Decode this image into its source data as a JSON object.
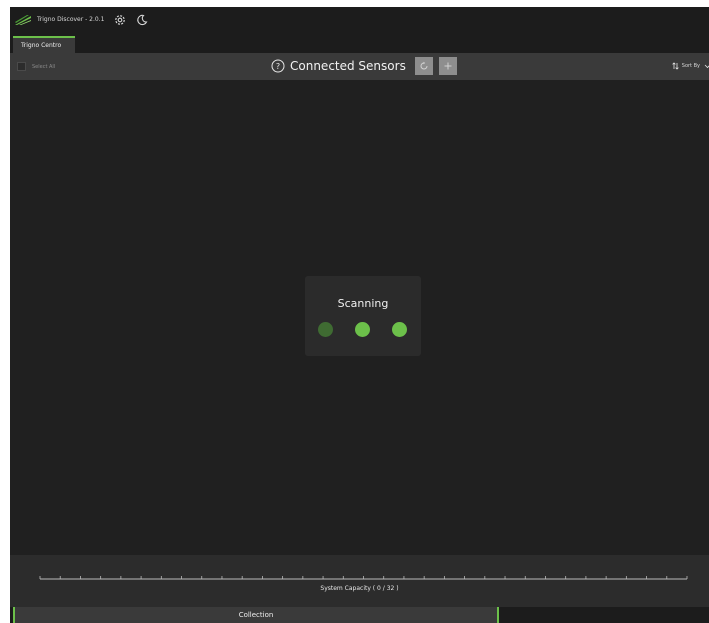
{
  "app": {
    "title": "Trigno Discover - 2.0.1"
  },
  "titlebar": {
    "icons": [
      "logo-icon",
      "settings-gear-icon",
      "dark-mode-moon-icon"
    ]
  },
  "tabs": [
    {
      "label": "Trigno Centro",
      "active": true
    }
  ],
  "toolbar": {
    "select_all_label": "Select All",
    "title": "Connected Sensors",
    "sort_label": "Sort By",
    "icons": [
      "help-icon",
      "refresh-icon",
      "add-icon",
      "sort-icon",
      "chevron-down-icon"
    ]
  },
  "scanning": {
    "label": "Scanning",
    "dots": [
      "#3f6b32",
      "#6cc04a",
      "#6cc04a"
    ]
  },
  "capacity": {
    "label": "System Capacity ( 0 / 32 )",
    "used": 0,
    "total": 32
  },
  "bottom": {
    "collection_label": "Collection"
  },
  "colors": {
    "accent": "#6cc04a",
    "background": "#1f1f1f",
    "panel": "#3a3a3a"
  }
}
